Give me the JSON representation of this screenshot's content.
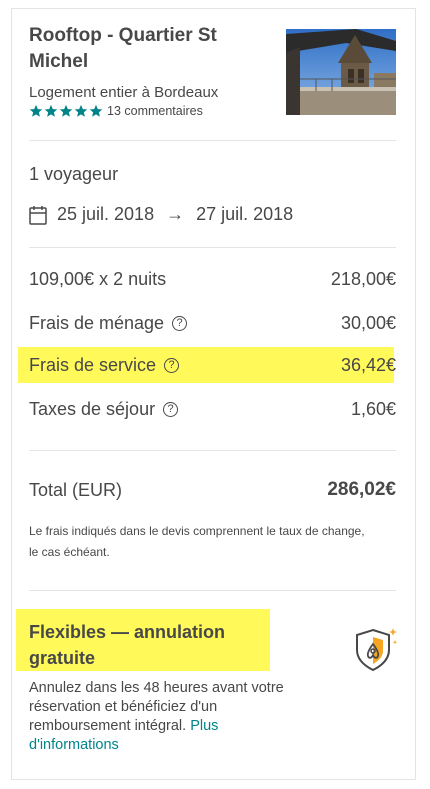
{
  "listing": {
    "title": "Rooftop - Quartier St Michel",
    "subtitle": "Logement entier à Bordeaux",
    "stars": 5,
    "reviews": "13 commentaires",
    "thumbnail_icon": "rooftop-photo"
  },
  "trip": {
    "guests": "1 voyageur",
    "checkin": "25 juil. 2018",
    "checkout": "27 juil. 2018",
    "arrow": "→",
    "calendar_icon": "calendar-icon"
  },
  "pricing": {
    "nightly_label": "109,00€ x 2 nuits",
    "nightly_value": "218,00€",
    "cleaning_label": "Frais de ménage",
    "cleaning_value": "30,00€",
    "service_label": "Frais de service",
    "service_value": "36,42€",
    "tax_label": "Taxes de séjour",
    "tax_value": "1,60€",
    "help_glyph": "?",
    "total_label": "Total (EUR)",
    "total_value": "286,02€"
  },
  "note": "Le frais indiqués dans le devis comprennent le taux de change, le cas échéant.",
  "flexible": {
    "title": "Flexibles — annulation gratuite",
    "description": "Annulez dans les 48 heures avant votre réservation et bénéficiez d'un remboursement intégral.",
    "link": "Plus d'informations"
  },
  "colors": {
    "accent_teal": "#008489",
    "highlight": "#fff95a",
    "text": "#484848",
    "shield_orange": "#f5a623"
  }
}
